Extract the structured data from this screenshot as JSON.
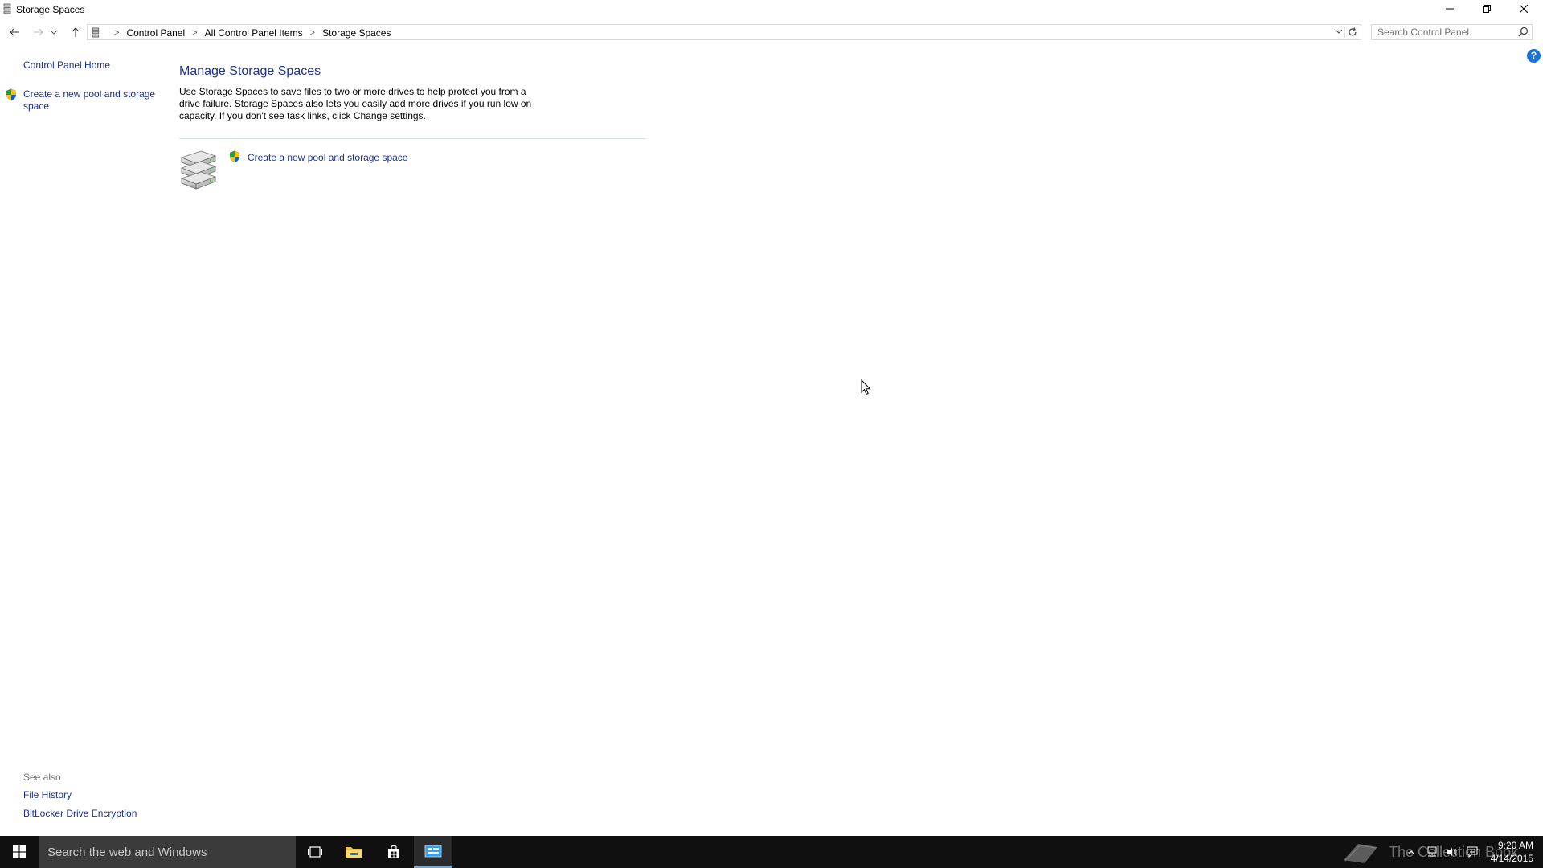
{
  "window": {
    "title": "Storage Spaces",
    "controls": {
      "minimize": "minimize",
      "maximize": "restore",
      "close": "close"
    }
  },
  "address_bar": {
    "breadcrumbs": [
      "Control Panel",
      "All Control Panel Items",
      "Storage Spaces"
    ],
    "search_placeholder": "Search Control Panel"
  },
  "left_pane": {
    "home_link": "Control Panel Home",
    "task_link": "Create a new pool and storage space",
    "see_also_label": "See also",
    "see_also_links": [
      "File History",
      "BitLocker Drive Encryption"
    ]
  },
  "main": {
    "heading": "Manage Storage Spaces",
    "description": "Use Storage Spaces to save files to two or more drives to help protect you from a drive failure. Storage Spaces also lets you easily add more drives if you run low on capacity. If you don't see task links, click Change settings.",
    "create_link": "Create a new pool and storage space"
  },
  "taskbar": {
    "search_placeholder": "Search the web and Windows",
    "watermark": "The Collection Book",
    "time": "9:20 AM",
    "date": "4/14/2015"
  },
  "colors": {
    "link": "#1e3287",
    "taskbar": "#101010",
    "taskbar_search": "#3b3b3b",
    "help_blue": "#1a73d0"
  }
}
